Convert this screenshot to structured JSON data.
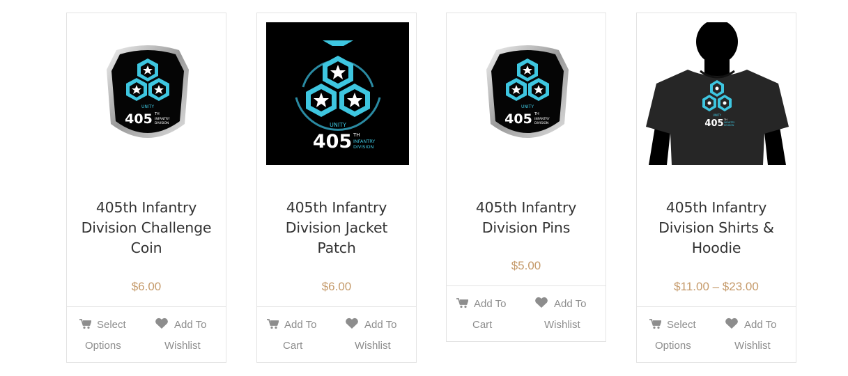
{
  "products": [
    {
      "title": "405th Infantry Division Challenge Coin",
      "price": "$6.00",
      "action_cart_line1": "Select",
      "action_cart_line2": "Options",
      "action_wish_line1": "Add To",
      "action_wish_line2": "Wishlist",
      "emblem_number": "405",
      "emblem_sup": "TH",
      "emblem_sub1": "INFANTRY",
      "emblem_sub2": "DIVISION",
      "emblem_unity": "UNITY"
    },
    {
      "title": "405th Infantry Division Jacket Patch",
      "price": "$6.00",
      "action_cart_line1": "Add To",
      "action_cart_line2": "Cart",
      "action_wish_line1": "Add To",
      "action_wish_line2": "Wishlist",
      "emblem_number": "405",
      "emblem_sup": "TH",
      "emblem_sub1": "INFANTRY",
      "emblem_sub2": "DIVISION",
      "emblem_unity": "UNITY"
    },
    {
      "title": "405th Infantry Division Pins",
      "price": "$5.00",
      "action_cart_line1": "Add To",
      "action_cart_line2": "Cart",
      "action_wish_line1": "Add To",
      "action_wish_line2": "Wishlist",
      "emblem_number": "405",
      "emblem_sup": "TH",
      "emblem_sub1": "INFANTRY",
      "emblem_sub2": "DIVISION",
      "emblem_unity": "UNITY"
    },
    {
      "title": "405th Infantry Division Shirts & Hoodie",
      "price": "$11.00 – $23.00",
      "action_cart_line1": "Select",
      "action_cart_line2": "Options",
      "action_wish_line1": "Add To",
      "action_wish_line2": "Wishlist",
      "emblem_number": "405",
      "emblem_sup": "TH",
      "emblem_sub1": "INFANTRY",
      "emblem_sub2": "DIVISION",
      "emblem_unity": "UNITY"
    }
  ],
  "colors": {
    "price": "#c59a6a",
    "title": "#333333",
    "action": "#8d8d8d",
    "emblem_cyan": "#3ec6e0",
    "border": "#e3e3e3"
  },
  "icons": {
    "cart": "cart-icon",
    "wishlist": "heart-icon"
  }
}
